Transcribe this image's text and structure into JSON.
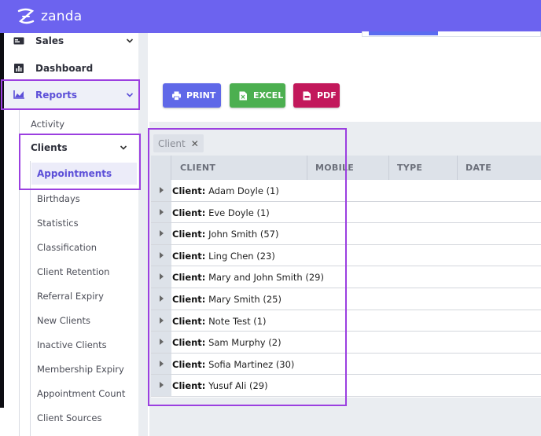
{
  "app": {
    "brand": "zanda",
    "brand_color": "#6c63ef",
    "accent": "#5c4fd8",
    "highlight_color": "#9b3fe0"
  },
  "sidebar": {
    "items": [
      {
        "label": "Sales",
        "icon": "sales-icon"
      },
      {
        "label": "Dashboard",
        "icon": "dashboard-icon"
      },
      {
        "label": "Reports",
        "icon": "reports-chart-icon"
      }
    ],
    "reports_sub": {
      "activity": "Activity",
      "clients": "Clients"
    },
    "clients_sub": [
      "Appointments",
      "Birthdays",
      "Statistics",
      "Classification",
      "Client Retention",
      "Referral Expiry",
      "New Clients",
      "Inactive Clients",
      "Membership Expiry",
      "Appointment Count",
      "Client Sources"
    ]
  },
  "toolbar": {
    "print": "PRINT",
    "excel": "EXCEL",
    "pdf": "PDF"
  },
  "group_chip": {
    "label": "Client",
    "remove": "✕"
  },
  "table": {
    "columns": [
      "CLIENT",
      "MOBILE",
      "TYPE",
      "DATE"
    ],
    "group_prefix": "Client:",
    "rows": [
      {
        "name": "Adam Doyle",
        "count": "(1)"
      },
      {
        "name": "Eve Doyle",
        "count": "(1)"
      },
      {
        "name": "John Smith",
        "count": "(57)"
      },
      {
        "name": "Ling Chen",
        "count": "(23)"
      },
      {
        "name": "Mary and John Smith",
        "count": "(29)"
      },
      {
        "name": "Mary Smith",
        "count": "(25)"
      },
      {
        "name": "Note Test",
        "count": "(1)"
      },
      {
        "name": "Sam Murphy",
        "count": "(2)"
      },
      {
        "name": "Sofia Martinez",
        "count": "(30)"
      },
      {
        "name": "Yusuf Ali",
        "count": "(29)"
      }
    ]
  }
}
